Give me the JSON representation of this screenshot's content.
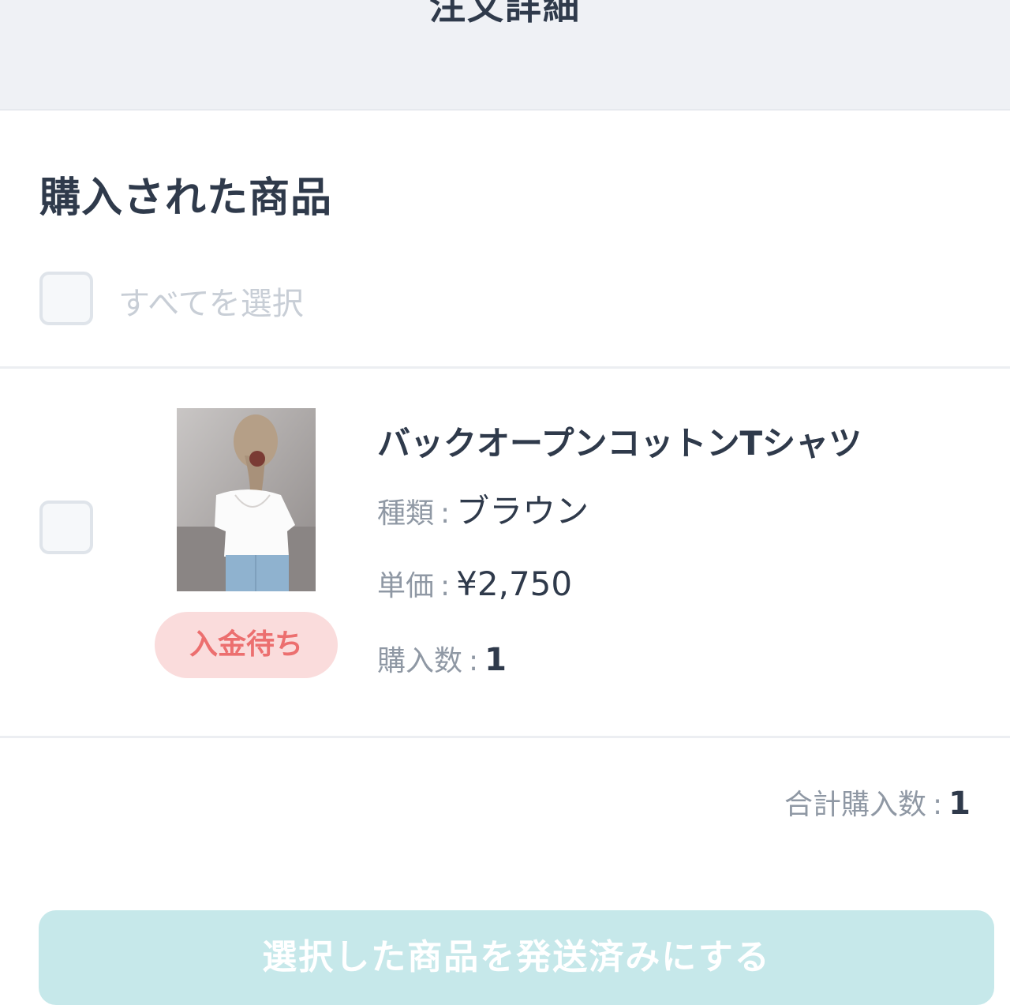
{
  "header": {
    "title": "注文詳細"
  },
  "section": {
    "title": "購入された商品"
  },
  "select_all": {
    "label": "すべてを選択",
    "checked": false
  },
  "items": [
    {
      "name": "バックオープンコットンTシャツ",
      "status": "入金待ち",
      "checked": false,
      "attributes": {
        "type_label": "種類",
        "type_value": "ブラウン",
        "price_label": "単価",
        "price_value": "¥2,750",
        "quantity_label": "購入数",
        "quantity_value": "1"
      },
      "image_icon": "product-photo"
    }
  ],
  "summary": {
    "total_label": "合計購入数",
    "total_value": "1"
  },
  "action": {
    "label": "選択した商品を発送済みにする"
  },
  "colors": {
    "header_bg": "#eff1f5",
    "text_primary": "#2f3a4b",
    "text_muted": "#8f98a4",
    "badge_bg": "#fadcdc",
    "badge_text": "#ec6f6f",
    "button_bg": "#c6e8ea"
  }
}
